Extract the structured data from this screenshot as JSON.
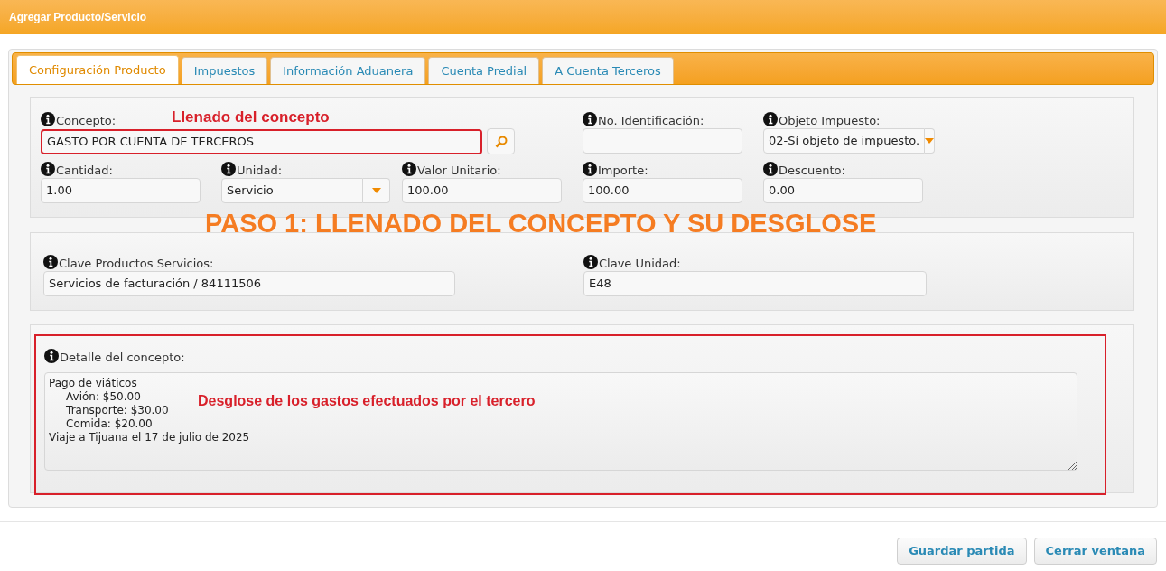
{
  "window": {
    "title": "Agregar Producto/Servicio"
  },
  "tabs": [
    {
      "label": "Configuración Producto",
      "selected": true
    },
    {
      "label": "Impuestos",
      "selected": false
    },
    {
      "label": "Información Aduanera",
      "selected": false
    },
    {
      "label": "Cuenta Predial",
      "selected": false
    },
    {
      "label": "A Cuenta Terceros",
      "selected": false
    }
  ],
  "section_1": {
    "annotation": "Llenado del concepto",
    "concept": {
      "kind": "search",
      "label": "Concepto:",
      "value": "GASTO POR CUENTA DE TERCEROS",
      "highlighted": true
    },
    "side_fields": [
      {
        "kind": "text",
        "label": "No. Identificación:"
      },
      {
        "kind": "select",
        "label": "Objeto Impuesto:",
        "value": "02-Sí objeto de impuesto."
      }
    ],
    "amounts": [
      {
        "kind": "text",
        "label": "Cantidad:",
        "value": "1.00"
      },
      {
        "kind": "select",
        "label": "Unidad:",
        "value": "Servicio"
      },
      {
        "kind": "text",
        "label": "Valor Unitario:",
        "value": "100.00"
      },
      {
        "kind": "text",
        "label": "Importe:",
        "value": "100.00"
      },
      {
        "kind": "text",
        "label": "Descuento:",
        "value": "0.00"
      }
    ]
  },
  "banner": "PASO 1: LLENADO DEL CONCEPTO Y SU DESGLOSE",
  "section_2": {
    "fields": [
      {
        "label": "Clave Productos Servicios:",
        "value": "Servicios de facturación / 84111506"
      },
      {
        "label": "Clave Unidad:",
        "value": "E48"
      }
    ]
  },
  "section_3": {
    "label": "Detalle del concepto:",
    "value": "Pago de viáticos\n     Avión: $50.00\n     Transporte: $30.00\n     Comida: $20.00\nViaje a Tijuana el 17 de julio de 2025",
    "annotation": "Desglose de los gastos efectuados por el tercero",
    "highlighted": true
  },
  "buttons": [
    "Guardar partida",
    "Cerrar ventana"
  ]
}
